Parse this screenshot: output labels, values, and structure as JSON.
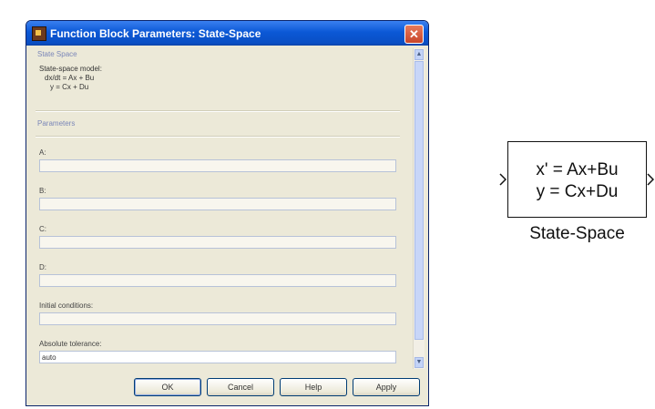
{
  "window": {
    "title": "Function Block Parameters: State-Space",
    "close_glyph": "✕"
  },
  "section": {
    "title": "State Space",
    "description": [
      "State-space model:",
      "dx/dt = Ax + Bu",
      "y = Cx + Du"
    ]
  },
  "parameters": {
    "title": "Parameters",
    "fields": [
      {
        "label": "A:",
        "value": ""
      },
      {
        "label": "B:",
        "value": ""
      },
      {
        "label": "C:",
        "value": ""
      },
      {
        "label": "D:",
        "value": ""
      },
      {
        "label": "Initial conditions:",
        "value": ""
      },
      {
        "label": "Absolute tolerance:",
        "value": "auto"
      }
    ]
  },
  "buttons": {
    "ok": "OK",
    "cancel": "Cancel",
    "help": "Help",
    "apply": "Apply"
  },
  "block": {
    "line1": "x' = Ax+Bu",
    "line2": "y = Cx+Du",
    "name": "State-Space"
  },
  "colors": {
    "titlebar": "#0b58d6",
    "dialog_bg": "#ece9d8",
    "section_title": "#7a86b8"
  }
}
